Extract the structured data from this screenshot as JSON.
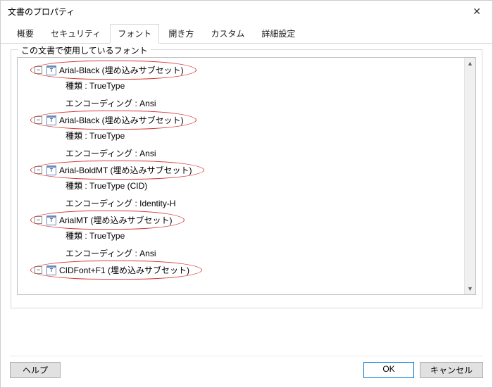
{
  "window": {
    "title": "文書のプロパティ",
    "close_glyph": "✕"
  },
  "tabs": {
    "items": [
      "概要",
      "セキュリティ",
      "フォント",
      "開き方",
      "カスタム",
      "詳細設定"
    ],
    "active_index": 2
  },
  "group": {
    "label": "この文書で使用しているフォント"
  },
  "fonts": [
    {
      "name": "Arial-Black (埋め込みサブセット)",
      "type": "種類 : TrueType",
      "encoding": "エンコーディング : Ansi",
      "highlighted": true
    },
    {
      "name": "Arial-Black (埋め込みサブセット)",
      "type": "種類 : TrueType",
      "encoding": "エンコーディング : Ansi",
      "highlighted": true
    },
    {
      "name": "Arial-BoldMT (埋め込みサブセット)",
      "type": "種類 : TrueType (CID)",
      "encoding": "エンコーディング : Identity-H",
      "highlighted": true
    },
    {
      "name": "ArialMT (埋め込みサブセット)",
      "type": "種類 : TrueType",
      "encoding": "エンコーディング : Ansi",
      "highlighted": true
    },
    {
      "name": "CIDFont+F1 (埋め込みサブセット)",
      "type": "",
      "encoding": "",
      "highlighted": true
    }
  ],
  "icons": {
    "expander_glyph": "−",
    "tt_glyph": "T"
  },
  "buttons": {
    "help": "ヘルプ",
    "ok": "OK",
    "cancel": "キャンセル"
  },
  "scroll": {
    "up": "▲",
    "down": "▼"
  }
}
